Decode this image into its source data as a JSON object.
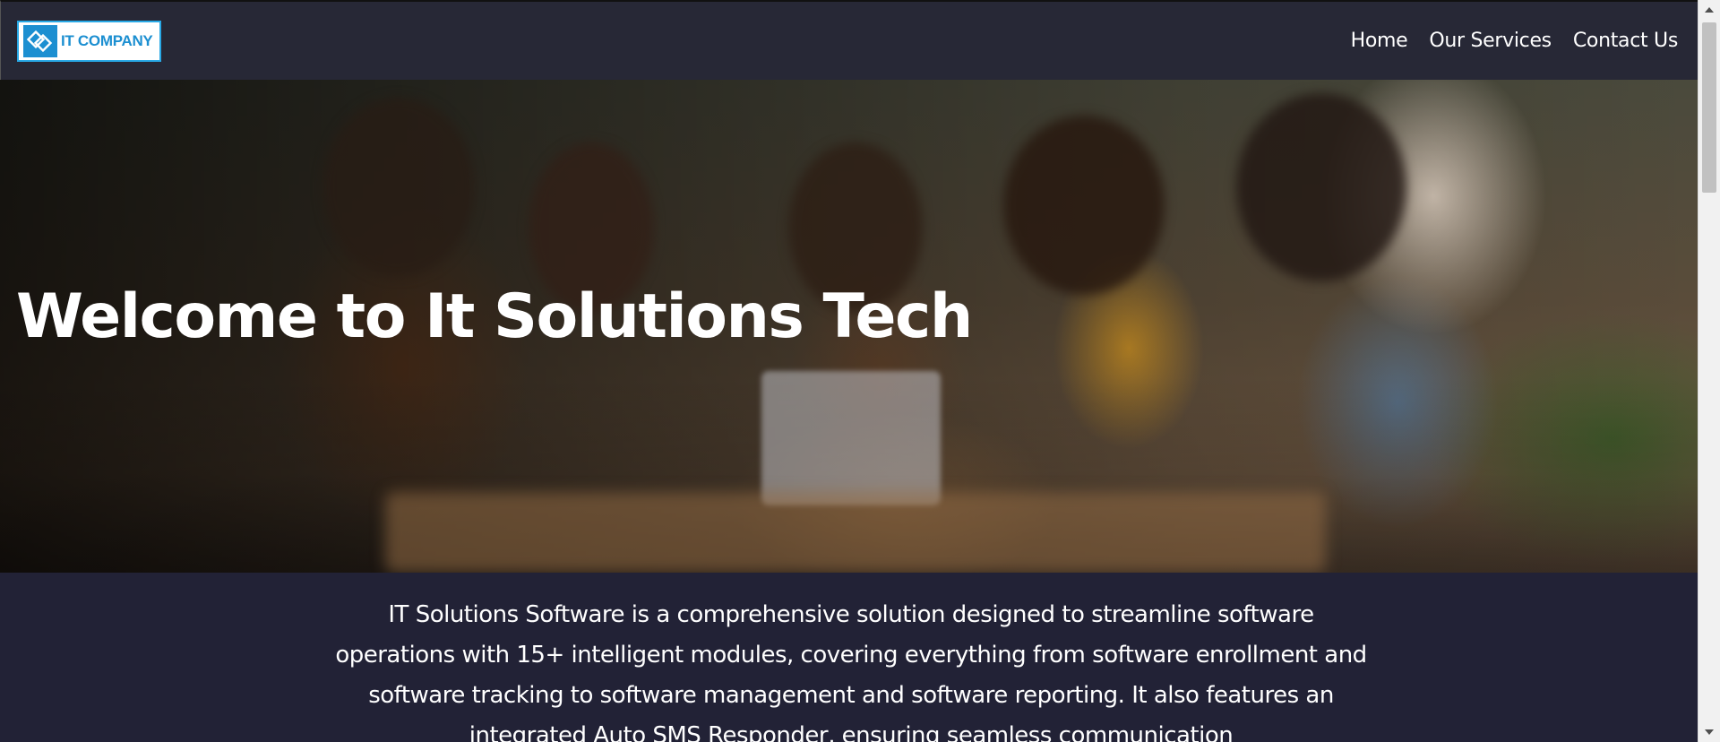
{
  "navbar": {
    "logo_text": "IT COMPANY",
    "links": [
      {
        "label": "Home"
      },
      {
        "label": "Our Services"
      },
      {
        "label": "Contact Us"
      }
    ]
  },
  "hero": {
    "title": "Welcome to It Solutions Tech",
    "image_icon": "team-photo"
  },
  "description": {
    "text": "IT Solutions Software is a comprehensive solution designed to streamline software operations with 15+ intelligent modules, covering everything from software enrollment and software tracking to software management and software reporting. It also features an integrated Auto SMS Responder, ensuring seamless communication"
  },
  "colors": {
    "nav_bg": "#272836",
    "page_bg": "#222236",
    "logo_accent": "#1c8fd1"
  }
}
